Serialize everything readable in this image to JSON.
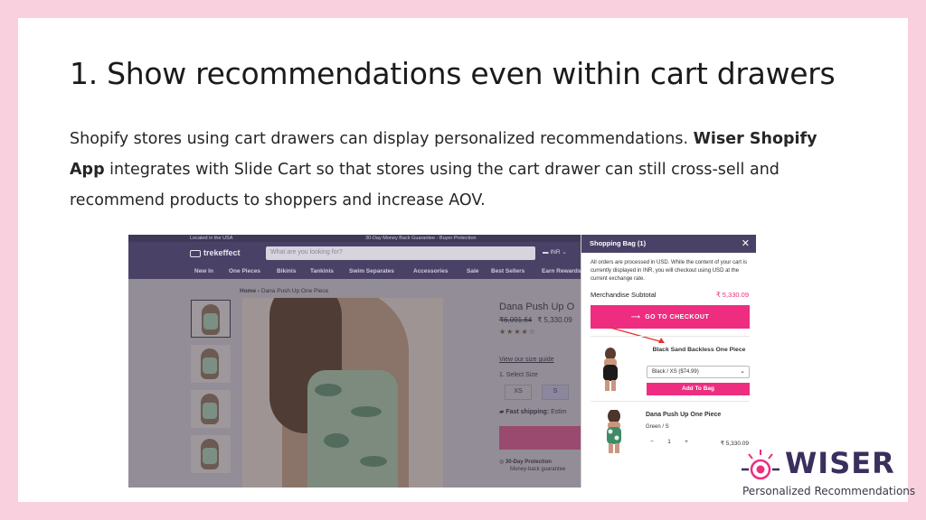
{
  "slide": {
    "heading": "1.  Show recommendations even within cart drawers",
    "body_part1": "Shopify stores using cart drawers can display personalized recommendations. ",
    "body_bold": "Wiser Shopify App",
    "body_part2": " integrates with Slide Cart so that stores using the cart drawer can still cross-sell and recommend products to shoppers and increase AOV."
  },
  "store": {
    "topbar_left": "Located in the USA",
    "topbar_center": "30-Day Money Back Guarantee - Buyer Protection",
    "logo": "trekeffect",
    "search_placeholder": "What are you looking for?",
    "currency": "INR",
    "nav": [
      "New In",
      "One Pieces",
      "Bikinis",
      "Tankinis",
      "Swim Separates",
      "Accessories",
      "Sale",
      "Best Sellers",
      "Earn Rewards"
    ],
    "breadcrumb_home": "Home",
    "breadcrumb_current": "Dana Push Up One Piece",
    "product_title": "Dana Push Up O",
    "old_price": "₹6,091.64",
    "price": "₹ 5,330.09",
    "stars": "★★★★☆",
    "size_guide": "View our size guide",
    "select_size": "1. Select Size",
    "sizes": [
      "XS",
      "S"
    ],
    "shipping_bold": "Fast shipping:",
    "shipping_text": "Estim",
    "guarantee_title": "30-Day Protection",
    "guarantee_text": "Money-back guarantee"
  },
  "drawer": {
    "title": "Shopping Bag (1)",
    "close": "✕",
    "notice": "All orders are processed in USD. While the content of your cart is currently displayed in INR, you will checkout using USD at the current exchange rate.",
    "subtotal_label": "Merchandise Subtotal",
    "subtotal_value": "₹ 5,330.09",
    "checkout_label": "GO TO CHECKOUT",
    "recommendation": {
      "name": "Black Sand Backless One Piece",
      "variant": "Black / XS ($74.99)",
      "add_label": "Add To Bag"
    },
    "item": {
      "name": "Dana Push Up One Piece",
      "variant": "Green / S",
      "qty_minus": "−",
      "qty": "1",
      "qty_plus": "+",
      "price": "₹ 5,330.09"
    }
  },
  "branding": {
    "wordmark": "WISER",
    "tagline": "Personalized Recommendations",
    "accent": "#ee2d81",
    "brand": "#3b2f5e"
  }
}
